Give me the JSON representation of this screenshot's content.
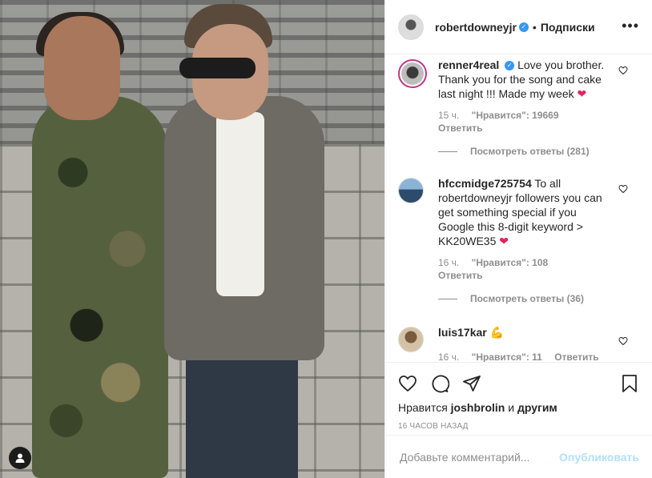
{
  "post": {
    "author": "robertdowneyjr",
    "separator": "•",
    "follow_label": "Подписки",
    "more_icon": "more-horizontal-icon"
  },
  "comments": [
    {
      "username": "renner4real",
      "verified": true,
      "text": "Love you brother. Thank you for the song and cake last night !!! Made my week",
      "emoji": "❤",
      "age": "15 ч.",
      "likes": "\"Нравится\": 19669",
      "reply_label": "Ответить",
      "view_replies": "Посмотреть ответы (281)"
    },
    {
      "username": "hfccmidge725754",
      "verified": false,
      "text": "To all robertdowneyjr followers you can get something special if you Google this 8-digit keyword > KK20WE35",
      "emoji": "❤",
      "age": "16 ч.",
      "likes": "\"Нравится\": 108",
      "reply_label": "Ответить",
      "view_replies": "Посмотреть ответы (36)"
    },
    {
      "username": "luis17kar",
      "verified": false,
      "text": "",
      "emoji": "💪",
      "age": "16 ч.",
      "likes": "\"Нравится\": 11",
      "reply_label": "Ответить"
    }
  ],
  "likes_summary": {
    "prefix": "Нравится",
    "user": "joshbrolin",
    "conj": "и",
    "others": "другим"
  },
  "timestamp": "16 ЧАСОВ НАЗАД",
  "add_comment": {
    "placeholder": "Добавьте комментарий...",
    "publish_label": "Опубликовать"
  },
  "colors": {
    "accent_blue": "#3897f0",
    "publish_disabled": "#b2dffc",
    "heart_red": "#ed4956",
    "muted_text": "#8e8e8e"
  }
}
